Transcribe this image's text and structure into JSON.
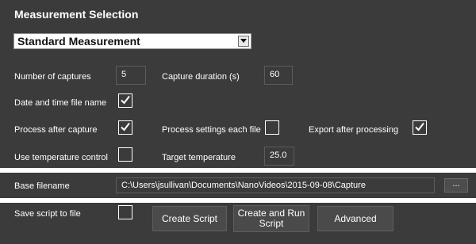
{
  "section": {
    "title": "Measurement Selection",
    "measurement_type": "Standard Measurement"
  },
  "settings": {
    "num_captures_label": "Number of captures",
    "num_captures_value": "5",
    "capture_duration_label": "Capture duration (s)",
    "capture_duration_value": "60",
    "date_time_filename_label": "Date and time file name",
    "date_time_filename_checked": true,
    "process_after_capture_label": "Process after capture",
    "process_after_capture_checked": true,
    "process_each_file_label": "Process settings each file",
    "process_each_file_checked": false,
    "export_after_processing_label": "Export after processing",
    "export_after_processing_checked": true,
    "use_temp_control_label": "Use temperature control",
    "use_temp_control_checked": false,
    "target_temp_label": "Target temperature",
    "target_temp_value": "25.0"
  },
  "file": {
    "base_filename_label": "Base filename",
    "base_filename_value": "C:\\Users\\jsullivan\\Documents\\NanoVideos\\2015-09-08\\Capture",
    "browse_label": "..."
  },
  "script": {
    "save_script_label": "Save script to file",
    "save_script_checked": false,
    "create_script_label": "Create Script",
    "create_run_script_label": "Create and Run Script",
    "advanced_label": "Advanced"
  },
  "colors": {
    "panel_bg": "#3b3b3b",
    "text": "#ffffff",
    "separator": "#ffffff"
  }
}
